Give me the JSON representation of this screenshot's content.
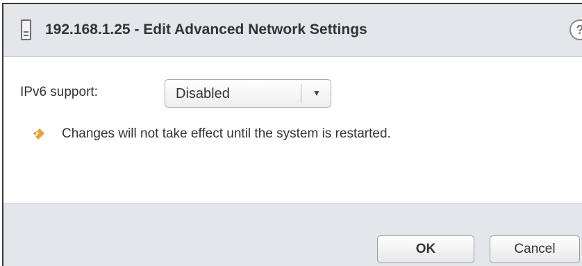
{
  "dialog": {
    "title": "192.168.1.25 - Edit Advanced Network Settings",
    "header_icon": "host-icon",
    "help_glyph": "?"
  },
  "settings": {
    "ipv6_label": "IPv6 support:",
    "ipv6_value": "Disabled",
    "ipv6_dropdown_icon": "chevron-down-icon",
    "warning_icon": "warning-icon",
    "warning_text": "Changes will not take effect until the system is restarted."
  },
  "footer": {
    "ok_label": "OK",
    "cancel_label": "Cancel"
  },
  "colors": {
    "chrome": "#e4e6ea",
    "text": "#333333",
    "warning": "#f0a030"
  }
}
